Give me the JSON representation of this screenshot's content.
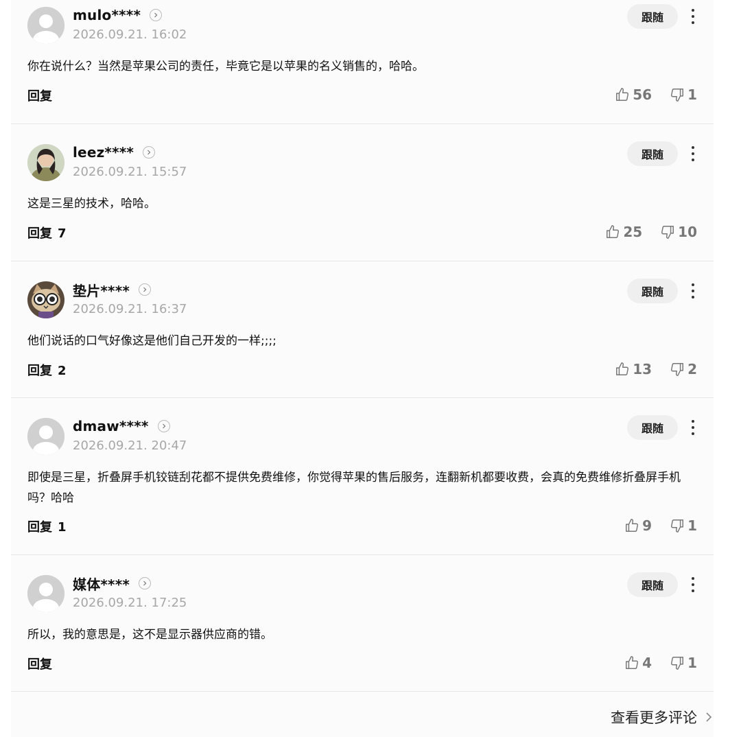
{
  "comments": [
    {
      "username": "mulo****",
      "time": "2026.09.21. 16:02",
      "follow_label": "跟随",
      "text": "你在说什么？当然是苹果公司的责任，毕竟它是以苹果的名义销售的，哈哈。",
      "reply_label": "回复",
      "reply_count": "",
      "likes": "56",
      "dislikes": "1"
    },
    {
      "username": "leez****",
      "time": "2026.09.21. 15:57",
      "follow_label": "跟随",
      "text": "这是三星的技术，哈哈。",
      "reply_label": "回复",
      "reply_count": "7",
      "likes": "25",
      "dislikes": "10"
    },
    {
      "username": "垫片****",
      "time": "2026.09.21. 16:37",
      "follow_label": "跟随",
      "text": "他们说话的口气好像这是他们自己开发的一样;;;;",
      "reply_label": "回复",
      "reply_count": "2",
      "likes": "13",
      "dislikes": "2"
    },
    {
      "username": "dmaw****",
      "time": "2026.09.21. 20:47",
      "follow_label": "跟随",
      "text": "即使是三星，折叠屏手机铰链刮花都不提供免费维修，你觉得苹果的售后服务，连翻新机都要收费，会真的免费维修折叠屏手机吗？哈哈",
      "reply_label": "回复",
      "reply_count": "1",
      "likes": "9",
      "dislikes": "1"
    },
    {
      "username": "媒体****",
      "time": "2026.09.21. 17:25",
      "follow_label": "跟随",
      "text": "所以，我的意思是，这不是显示器供应商的错。",
      "reply_label": "回复",
      "reply_count": "",
      "likes": "4",
      "dislikes": "1"
    }
  ],
  "more_comments_label": "查看更多评论",
  "icons": {
    "default_avatar": "person-silhouette",
    "like": "thumbs-up-outline",
    "dislike": "thumbs-down-outline",
    "more": "vertical-ellipsis",
    "profile": "chevron-right-circle"
  }
}
